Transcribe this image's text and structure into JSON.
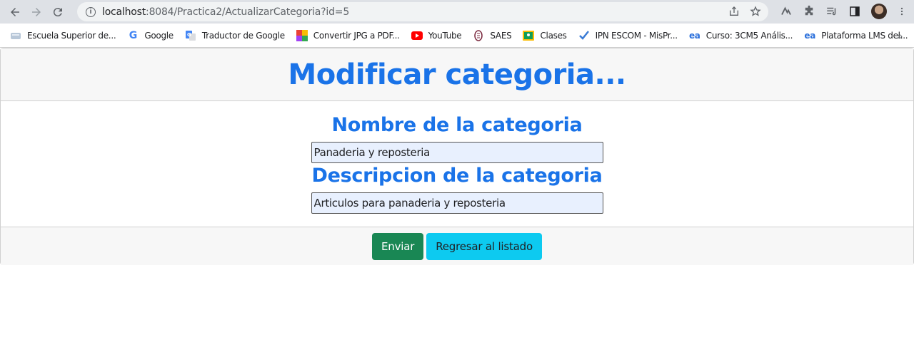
{
  "browser": {
    "url_host": "localhost",
    "url_rest": ":8084/Practica2/ActualizarCategoria?id=5"
  },
  "bookmarks": [
    {
      "label": "Escuela Superior de...",
      "icon": "school-icon"
    },
    {
      "label": "Google",
      "icon": "google-icon"
    },
    {
      "label": "Traductor de Google",
      "icon": "translate-icon"
    },
    {
      "label": "Convertir JPG a PDF...",
      "icon": "converter-icon"
    },
    {
      "label": "YouTube",
      "icon": "youtube-icon"
    },
    {
      "label": "SAES",
      "icon": "saes-icon"
    },
    {
      "label": "Clases",
      "icon": "classroom-icon"
    },
    {
      "label": "IPN ESCOM - MisPr...",
      "icon": "check-icon"
    },
    {
      "label": "Curso: 3CM5 Anális...",
      "icon": "ea-icon"
    },
    {
      "label": "Plataforma LMS del...",
      "icon": "ea-icon"
    }
  ],
  "page": {
    "title": "Modificar categoria...",
    "name_label": "Nombre de la categoria",
    "name_value": "Panaderia y reposteria",
    "desc_label": "Descripcion de la categoria",
    "desc_value": "Articulos para panaderia y reposteria",
    "submit_label": "Enviar",
    "back_label": "Regresar al listado"
  },
  "colors": {
    "heading": "#1a73e8",
    "submit": "#198754",
    "back": "#0dcaf0",
    "field_bg": "#e8f0fe"
  }
}
